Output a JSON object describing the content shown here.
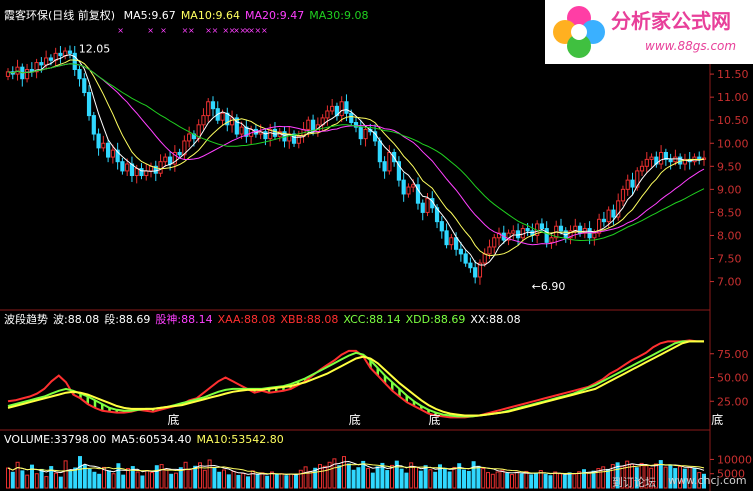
{
  "colors": {
    "bg": "#000000",
    "up": "#e83030",
    "down": "#30d8ff",
    "grid": "#8a1a1a",
    "ma5": "#ffffff",
    "ma10": "#ffff60",
    "ma20": "#ff40ff",
    "ma30": "#20d020",
    "wave": "#ff3030",
    "seg": "#7cff40",
    "axis": "#c83030"
  },
  "logo": {
    "title": "分析家公式网",
    "url": "www.88gs.com"
  },
  "watermark": {
    "left": "到订论坛",
    "right": "www.chcj.com"
  },
  "chart_data": [
    {
      "type": "candlestick",
      "title": "霞客环保(日线 前复权)",
      "ma_legend": [
        {
          "label": "MA5:9.67",
          "color": "#ffffff"
        },
        {
          "label": "MA10:9.64",
          "color": "#ffff60"
        },
        {
          "label": "MA20:9.47",
          "color": "#ff40ff"
        },
        {
          "label": "MA30:9.08",
          "color": "#20d020"
        }
      ],
      "ylim": [
        6.6,
        12.5
      ],
      "yticks": [
        "11.50",
        "11.00",
        "10.50",
        "10.00",
        "9.50",
        "9.00",
        "8.50",
        "8.00",
        "7.50",
        "7.00"
      ],
      "ytick_values": [
        11.5,
        11.0,
        10.5,
        10.0,
        9.5,
        9.0,
        8.5,
        8.0,
        7.5,
        7.0
      ],
      "annotations": [
        {
          "text": "12.05",
          "x": 14,
          "y": 12.05
        },
        {
          "text": "←6.90",
          "x": 109,
          "y": 6.9
        }
      ],
      "closes": [
        11.55,
        11.5,
        11.65,
        11.4,
        11.6,
        11.55,
        11.75,
        11.7,
        11.85,
        11.8,
        11.95,
        11.9,
        12.0,
        11.95,
        11.6,
        11.4,
        11.1,
        10.6,
        10.2,
        9.9,
        10.0,
        9.7,
        9.85,
        9.6,
        9.4,
        9.55,
        9.3,
        9.45,
        9.3,
        9.4,
        9.5,
        9.35,
        9.6,
        9.7,
        9.55,
        9.8,
        9.75,
        10.05,
        10.2,
        10.1,
        10.4,
        10.6,
        10.9,
        10.75,
        10.5,
        10.65,
        10.4,
        10.55,
        10.2,
        10.35,
        10.15,
        10.3,
        10.2,
        10.25,
        10.1,
        10.3,
        10.15,
        10.25,
        10.05,
        10.2,
        10.0,
        10.15,
        10.3,
        10.5,
        10.25,
        10.4,
        10.55,
        10.7,
        10.8,
        10.6,
        10.9,
        10.65,
        10.45,
        10.35,
        10.1,
        10.3,
        10.25,
        10.05,
        9.6,
        9.4,
        9.8,
        9.6,
        9.2,
        8.9,
        9.05,
        9.1,
        8.7,
        8.5,
        8.8,
        8.6,
        8.3,
        8.1,
        7.8,
        7.95,
        7.7,
        7.6,
        7.4,
        7.3,
        7.1,
        7.4,
        7.6,
        7.75,
        7.95,
        8.05,
        7.9,
        8.05,
        8.1,
        7.95,
        8.15,
        8.1,
        8.0,
        8.25,
        8.15,
        7.85,
        7.95,
        8.2,
        8.1,
        7.95,
        8.1,
        8.2,
        8.05,
        8.15,
        7.95,
        8.05,
        8.35,
        8.3,
        8.55,
        8.4,
        8.75,
        9.0,
        9.2,
        9.05,
        9.4,
        9.5,
        9.65,
        9.7,
        9.55,
        9.8,
        9.65,
        9.6,
        9.7,
        9.55,
        9.65,
        9.6,
        9.7,
        9.65,
        9.68
      ]
    },
    {
      "type": "line",
      "legend": [
        {
          "label": "波段趋势",
          "color": "#ffffff"
        },
        {
          "label": "波:88.08",
          "color": "#ffffff"
        },
        {
          "label": "段:88.69",
          "color": "#ffffff"
        },
        {
          "label": "股神:88.14",
          "color": "#ff40ff"
        },
        {
          "label": "XAA:88.08",
          "color": "#ff3030"
        },
        {
          "label": "XBB:88.08",
          "color": "#ff3030"
        },
        {
          "label": "XCC:88.14",
          "color": "#7cff40"
        },
        {
          "label": "XDD:88.69",
          "color": "#7cff40"
        },
        {
          "label": "XX:88.08",
          "color": "#ffffff"
        }
      ],
      "ylim": [
        0,
        100
      ],
      "yticks": [
        "75.00",
        "50.00",
        "25.00"
      ],
      "ytick_values": [
        75,
        50,
        25
      ],
      "markers": [
        {
          "text": "底",
          "x": 22
        },
        {
          "text": "底",
          "x": 47
        },
        {
          "text": "底",
          "x": 58
        },
        {
          "text": "底",
          "x": 97
        },
        {
          "text": "底",
          "x": 117
        },
        {
          "text": "底",
          "x": 126
        }
      ],
      "series": [
        {
          "values": [
            25,
            26,
            28,
            30,
            33,
            38,
            46,
            52,
            45,
            32,
            28,
            22,
            18,
            15,
            14,
            13,
            13,
            14,
            16,
            15,
            14,
            16,
            18,
            20,
            22,
            26,
            28,
            34,
            40,
            46,
            50,
            46,
            42,
            38,
            34,
            36,
            34,
            35,
            36,
            38,
            42,
            46,
            52,
            58,
            63,
            68,
            74,
            78,
            78,
            72,
            60,
            52,
            44,
            36,
            30,
            24,
            20,
            16,
            12,
            10,
            9,
            8,
            8,
            8,
            9,
            10,
            12,
            14,
            16,
            18,
            20,
            22,
            24,
            26,
            28,
            30,
            32,
            34,
            36,
            38,
            40,
            44,
            48,
            54,
            58,
            63,
            68,
            72,
            76,
            82,
            86,
            88,
            88,
            88,
            89,
            88,
            88
          ]
        },
        {
          "values": [
            20,
            22,
            24,
            26,
            28,
            30,
            33,
            36,
            38,
            36,
            33,
            30,
            26,
            22,
            18,
            16,
            15,
            15,
            16,
            17,
            17,
            18,
            19,
            21,
            23,
            25,
            27,
            29,
            32,
            35,
            37,
            38,
            38,
            38,
            38,
            38,
            39,
            40,
            41,
            43,
            46,
            49,
            53,
            57,
            61,
            65,
            69,
            73,
            76,
            74,
            68,
            60,
            52,
            45,
            38,
            31,
            25,
            20,
            16,
            13,
            11,
            10,
            9,
            9,
            9,
            10,
            11,
            12,
            13,
            15,
            17,
            19,
            21,
            23,
            25,
            27,
            29,
            31,
            33,
            36,
            39,
            42,
            46,
            50,
            54,
            58,
            62,
            66,
            70,
            74,
            78,
            82,
            86,
            88,
            88,
            88,
            88
          ]
        },
        {
          "values": [
            18,
            20,
            22,
            24,
            26,
            28,
            30,
            32,
            34,
            35,
            34,
            32,
            29,
            26,
            23,
            20,
            18,
            17,
            17,
            17,
            17,
            18,
            19,
            20,
            21,
            23,
            25,
            27,
            29,
            31,
            33,
            35,
            36,
            37,
            37,
            37,
            38,
            39,
            40,
            41,
            43,
            45,
            48,
            51,
            54,
            58,
            62,
            66,
            70,
            72,
            70,
            65,
            58,
            51,
            44,
            38,
            32,
            26,
            21,
            17,
            14,
            12,
            11,
            10,
            10,
            10,
            11,
            12,
            13,
            14,
            16,
            18,
            20,
            22,
            24,
            26,
            28,
            30,
            32,
            34,
            36,
            38,
            42,
            46,
            50,
            54,
            58,
            62,
            66,
            70,
            74,
            78,
            82,
            86,
            88,
            88,
            88
          ]
        }
      ]
    },
    {
      "type": "bar",
      "legend": [
        {
          "label": "VOLUME:33798.00",
          "color": "#ffffff"
        },
        {
          "label": "MA5:60534.40",
          "color": "#ffffff"
        },
        {
          "label": "MA10:53542.80",
          "color": "#ffff60"
        }
      ],
      "ylim": [
        0,
        14000
      ],
      "yticks": [
        "10000",
        "5000"
      ],
      "ytick_values": [
        10000,
        5000
      ],
      "values": [
        7000,
        5500,
        9000,
        6000,
        4500,
        8000,
        5000,
        6500,
        4000,
        7500,
        5200,
        3800,
        9500,
        6200,
        7000,
        11000,
        8000,
        6500,
        5500,
        4800,
        7200,
        6000,
        5000,
        8500,
        4500,
        6800,
        7500,
        5600,
        4200,
        6100,
        5400,
        7800,
        8200,
        6600,
        4800,
        5200,
        7100,
        9000,
        6400,
        7600,
        8800,
        6200,
        9800,
        7000,
        5500,
        6300,
        4600,
        5800,
        4400,
        5100,
        3900,
        6000,
        4800,
        5300,
        4100,
        5600,
        4700,
        5000,
        4300,
        4900,
        4400,
        6200,
        7400,
        5800,
        6900,
        8200,
        7600,
        9000,
        10200,
        7800,
        11000,
        8400,
        6200,
        7100,
        9300,
        6800,
        5200,
        7400,
        8600,
        6100,
        7900,
        9400,
        6600,
        5200,
        8800,
        7300,
        5900,
        7800,
        6400,
        5500,
        8100,
        6900,
        5600,
        7200,
        8500,
        6300,
        5800,
        9200,
        7600,
        6800,
        5400,
        4800,
        5600,
        6200,
        5100,
        4700,
        5500,
        4900,
        5800,
        4600,
        5200,
        6100,
        4800,
        4300,
        5600,
        5000,
        4500,
        5300,
        4900,
        5700,
        6400,
        5200,
        5900,
        6800,
        7400,
        6500,
        8200,
        8800,
        7600,
        9400,
        8300,
        7100,
        8600,
        7800,
        6900,
        8400,
        9600,
        7300,
        8100,
        6800,
        7500,
        6600,
        7200,
        6900,
        5400,
        4800
      ]
    }
  ]
}
